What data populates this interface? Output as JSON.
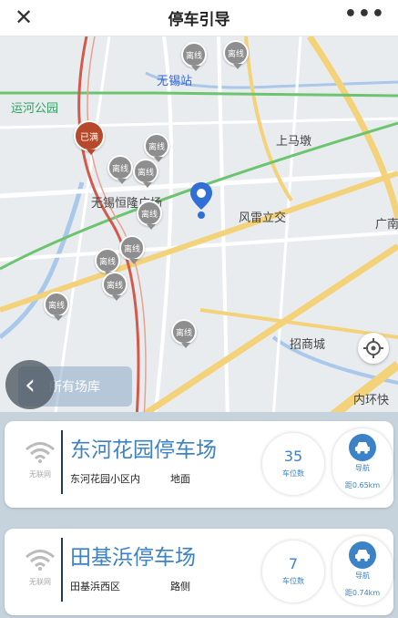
{
  "header": {
    "title": "停车引导",
    "close_icon": "close-icon",
    "more_icon": "more-icon"
  },
  "map": {
    "labels": {
      "station": "无锡站",
      "park": "运河公园",
      "mall": "无锡恒隆广场",
      "fenglei": "风雷立交",
      "shangmadun": "上马墩",
      "zhaoshang": "招商城",
      "guang": "广南",
      "neihuan": "内环快"
    },
    "pins": {
      "offline": "离线",
      "full": "已满"
    },
    "filter_label": "所有场库",
    "colors": {
      "road_yellow": "#f3d27a",
      "rail_green": "#6cc46f",
      "rail_red": "#d35a4a",
      "water": "#a9c8ea"
    }
  },
  "cards": [
    {
      "wifi_label": "无联网",
      "name": "东河花园停车场",
      "address": "东河花园小区内",
      "position": "地面",
      "spots": "35",
      "spots_label": "车位数",
      "nav_label": "导航",
      "distance": "距0.65km"
    },
    {
      "wifi_label": "无联网",
      "name": "田基浜停车场",
      "address": "田基浜西区",
      "position": "路侧",
      "spots": "7",
      "spots_label": "车位数",
      "nav_label": "导航",
      "distance": "距0.74km"
    }
  ]
}
